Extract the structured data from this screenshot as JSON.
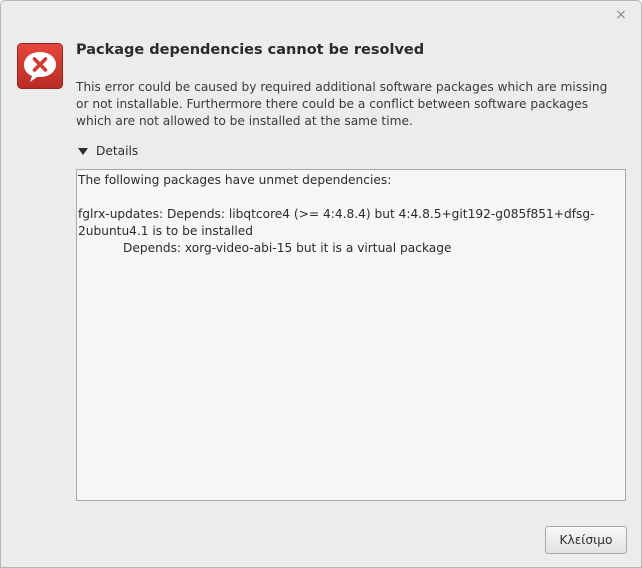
{
  "window": {
    "close_glyph": "×"
  },
  "dialog": {
    "icon": "error-icon",
    "title": "Package dependencies cannot be resolved",
    "message": "This error could be caused by required additional software packages which are missing or not installable. Furthermore there could be a conflict between software packages which are not allowed to be installed at the same time.",
    "details_label": "Details",
    "details_expanded": true,
    "details_lines": {
      "header": "The following packages have unmet dependencies:",
      "dep1": "fglrx-updates: Depends: libqtcore4 (>= 4:4.8.4) but 4:4.8.5+git192-g085f851+dfsg-2ubuntu4.1 is to be installed",
      "dep2": "Depends: xorg-video-abi-15 but it is a virtual package"
    },
    "close_button_label": "Κλείσιμο"
  },
  "colors": {
    "error_red": "#d33a32",
    "window_bg": "#ececec"
  }
}
